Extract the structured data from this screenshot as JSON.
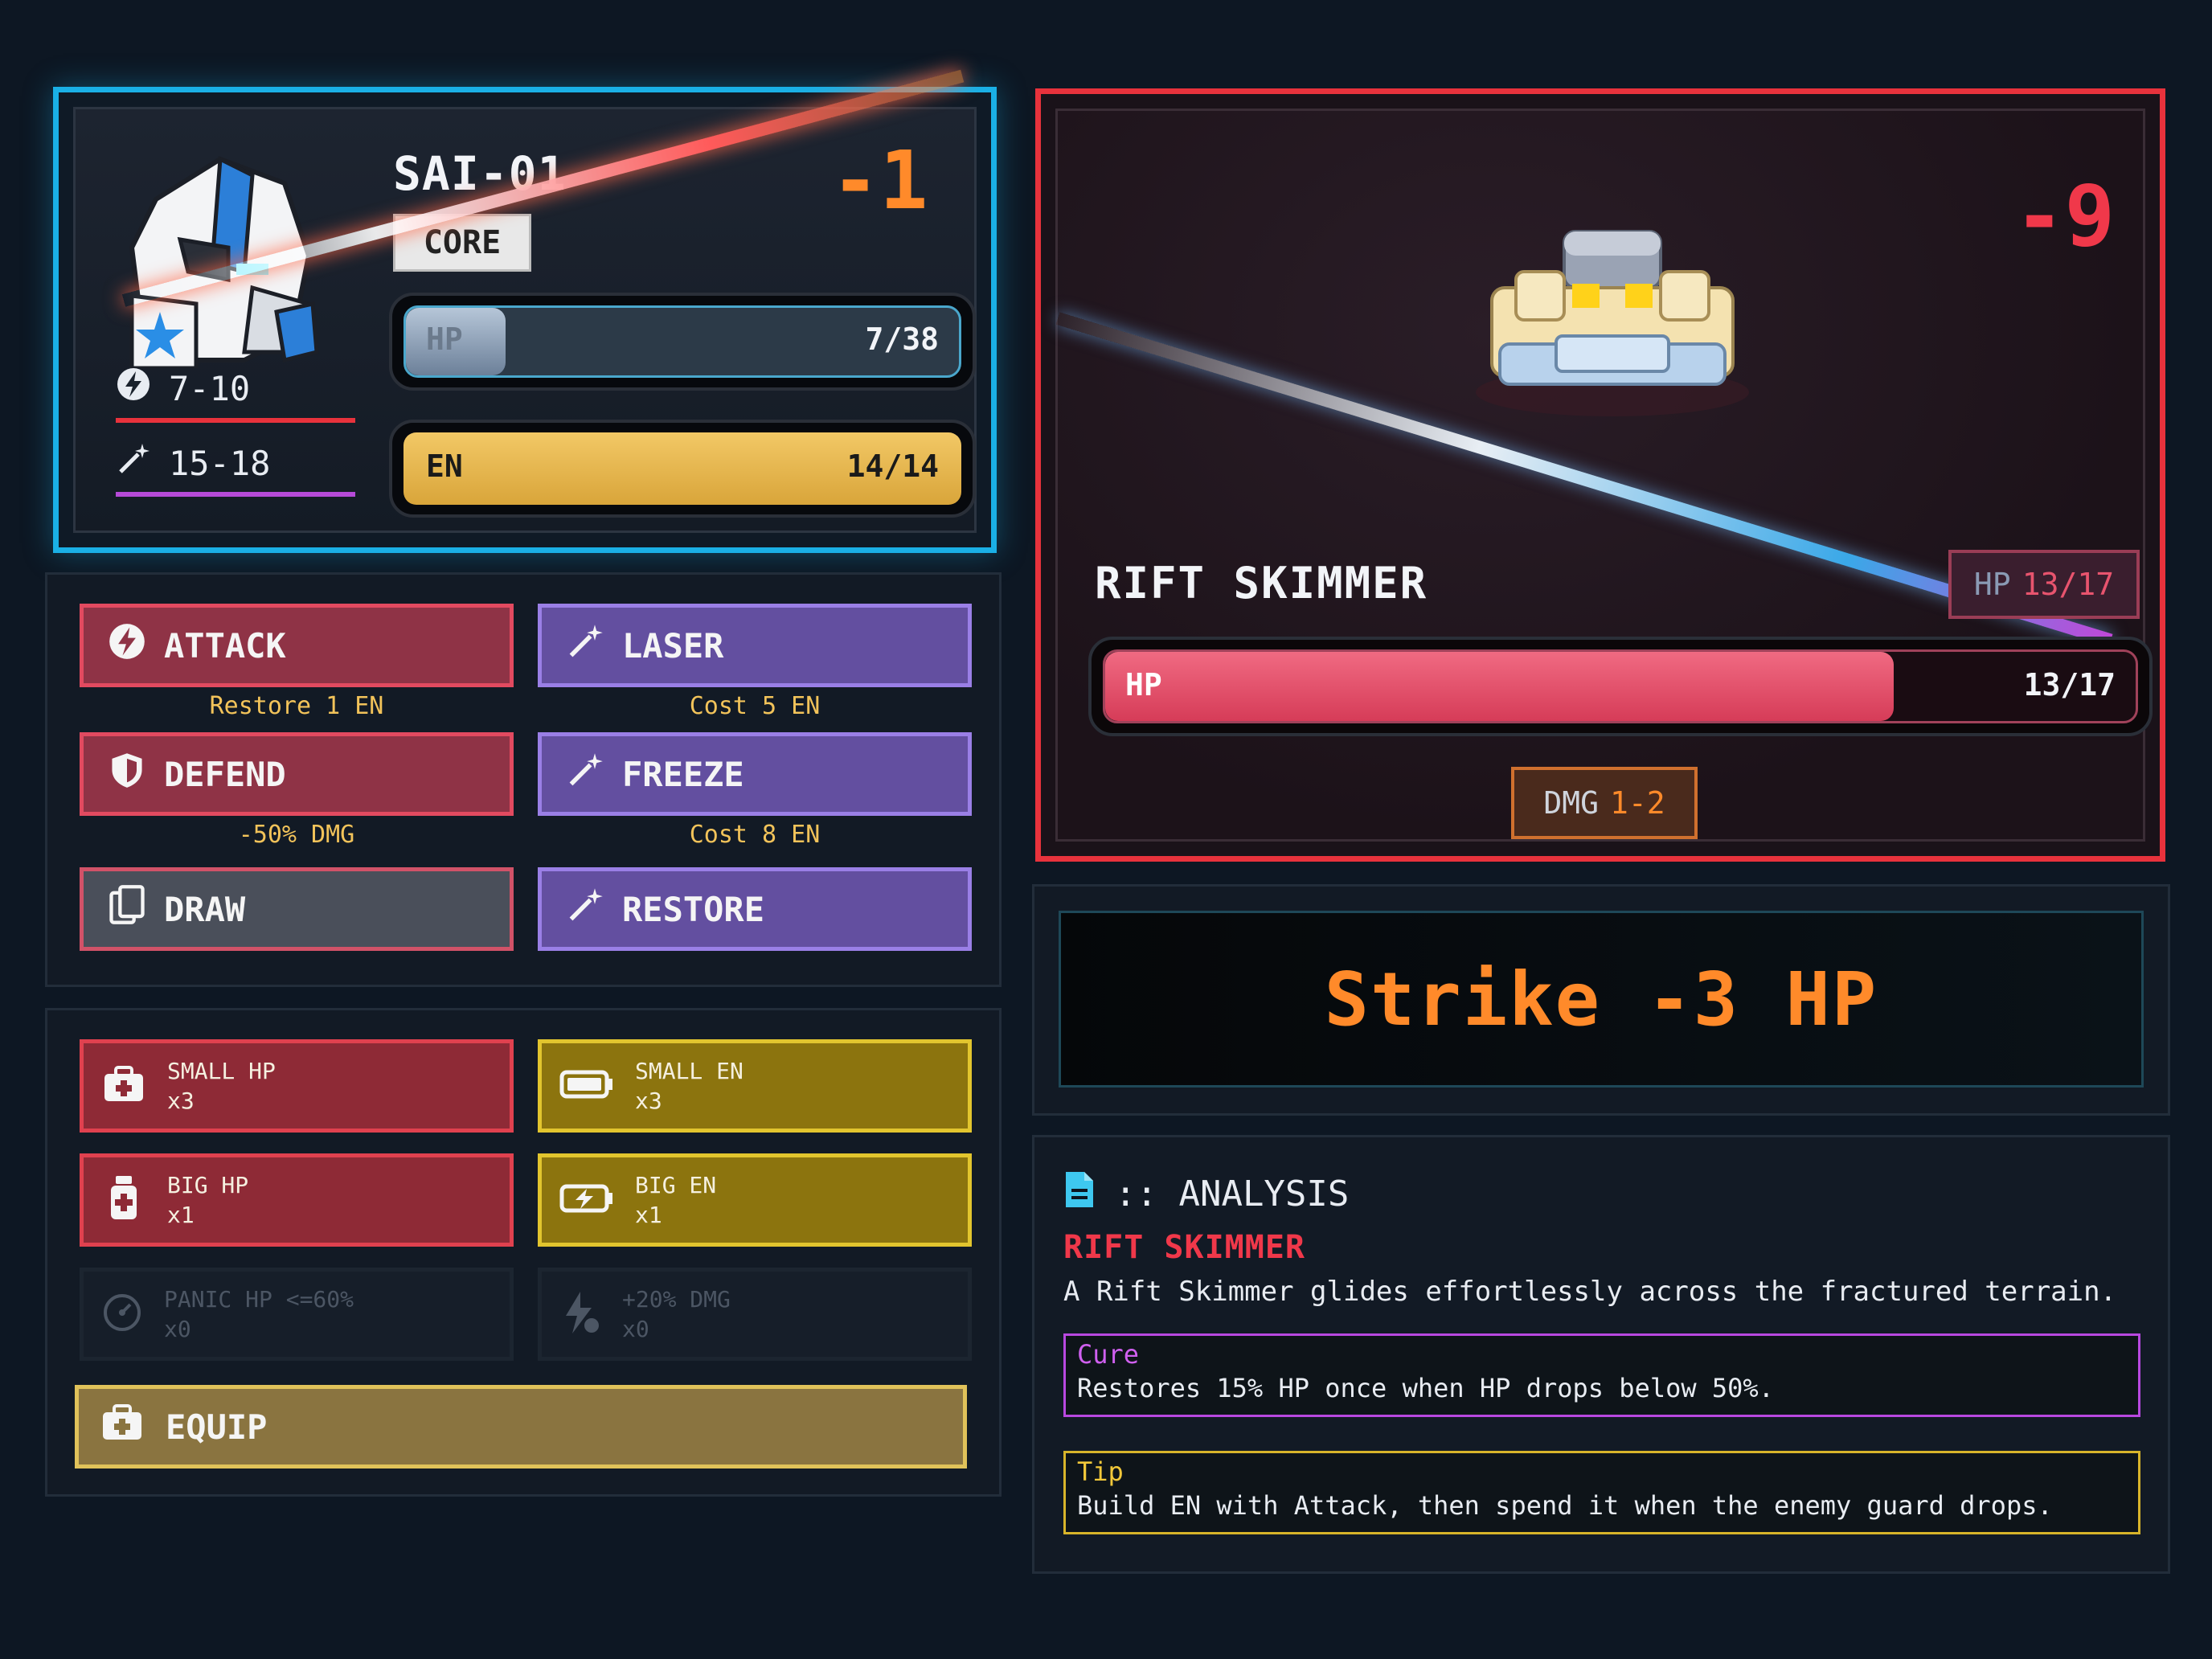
{
  "player": {
    "name": "SAI-01",
    "badge": "CORE",
    "damage_taken": "-1",
    "attack_range": "7-10",
    "laser_range": "15-18",
    "hp_label": "HP",
    "hp_text": "7/38",
    "hp_fraction": 0.18,
    "en_label": "EN",
    "en_text": "14/14",
    "en_fraction": 1.0
  },
  "actions": {
    "attack": "ATTACK",
    "attack_note": "Restore 1 EN",
    "laser": "LASER",
    "laser_note": "Cost 5 EN",
    "defend": "DEFEND",
    "defend_note": "-50% DMG",
    "freeze": "FREEZE",
    "freeze_note": "Cost 8 EN",
    "draw": "DRAW",
    "restore": "RESTORE"
  },
  "items": {
    "small_hp": {
      "name": "SMALL HP",
      "qty": "x3"
    },
    "small_en": {
      "name": "SMALL EN",
      "qty": "x3"
    },
    "big_hp": {
      "name": "BIG HP",
      "qty": "x1"
    },
    "big_en": {
      "name": "BIG EN",
      "qty": "x1"
    },
    "panic_hp": {
      "name": "PANIC HP <=60%",
      "qty": "x0"
    },
    "dmg_boost": {
      "name": "+20% DMG",
      "qty": "x0"
    },
    "equip": "EQUIP"
  },
  "enemy": {
    "name": "RIFT SKIMMER",
    "damage_taken": "-9",
    "hp_badge_label": "HP",
    "hp_badge_value": "13/17",
    "hp_label": "HP",
    "hp_text": "13/17",
    "hp_fraction": 0.765,
    "dmg_label": "DMG",
    "dmg_value": "1-2"
  },
  "log": {
    "message": "Strike -3 HP"
  },
  "analysis": {
    "header": ":: ANALYSIS",
    "enemy_name": "RIFT SKIMMER",
    "description": "A Rift Skimmer glides effortlessly across the fractured terrain.",
    "cure_title": "Cure",
    "cure_body": "Restores 15% HP once when HP drops below 50%.",
    "tip_title": "Tip",
    "tip_body": "Build EN with Attack, then spend it when the enemy guard drops."
  },
  "colors": {
    "player_border": "#1ab0e6",
    "enemy_border": "#e8323c",
    "hp_pink": "#e8546e",
    "en_gold": "#e8b84a",
    "damage_orange": "#ff8a2a",
    "enemy_damage_red": "#f0384a"
  },
  "icons": {
    "attack": "lightning-icon",
    "laser": "sparkle-wand-icon",
    "defend": "shield-icon",
    "draw": "cards-icon",
    "small_hp": "medkit-icon",
    "small_en": "battery-icon",
    "big_hp": "potion-bottle-icon",
    "big_en": "charging-battery-icon",
    "panic_hp": "gauge-icon",
    "dmg_boost": "bolt-plus-icon",
    "equip": "medkit-icon",
    "analysis": "document-icon"
  }
}
